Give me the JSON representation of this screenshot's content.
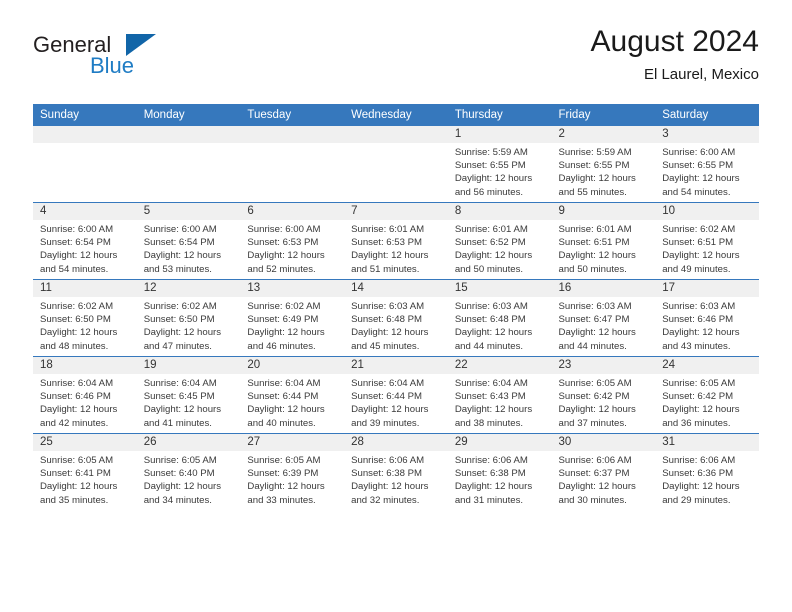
{
  "brand": {
    "name_part1": "General",
    "name_part2": "Blue",
    "logo_icon": "triangle-logo-icon"
  },
  "header": {
    "month_title": "August 2024",
    "location": "El Laurel, Mexico"
  },
  "colors": {
    "header_blue": "#3678bd",
    "brand_blue": "#1f7cc4",
    "daynum_bg": "#f0f0f0"
  },
  "weekday_headers": [
    "Sunday",
    "Monday",
    "Tuesday",
    "Wednesday",
    "Thursday",
    "Friday",
    "Saturday"
  ],
  "labels": {
    "sunrise_prefix": "Sunrise:",
    "sunset_prefix": "Sunset:",
    "daylight_prefix": "Daylight:"
  },
  "weeks": [
    [
      {
        "day": "",
        "sunrise": "",
        "sunset": "",
        "daylight_line1": "",
        "daylight_line2": "",
        "empty": true
      },
      {
        "day": "",
        "sunrise": "",
        "sunset": "",
        "daylight_line1": "",
        "daylight_line2": "",
        "empty": true
      },
      {
        "day": "",
        "sunrise": "",
        "sunset": "",
        "daylight_line1": "",
        "daylight_line2": "",
        "empty": true
      },
      {
        "day": "",
        "sunrise": "",
        "sunset": "",
        "daylight_line1": "",
        "daylight_line2": "",
        "empty": true
      },
      {
        "day": "1",
        "sunrise": "Sunrise: 5:59 AM",
        "sunset": "Sunset: 6:55 PM",
        "daylight_line1": "Daylight: 12 hours",
        "daylight_line2": "and 56 minutes.",
        "empty": false
      },
      {
        "day": "2",
        "sunrise": "Sunrise: 5:59 AM",
        "sunset": "Sunset: 6:55 PM",
        "daylight_line1": "Daylight: 12 hours",
        "daylight_line2": "and 55 minutes.",
        "empty": false
      },
      {
        "day": "3",
        "sunrise": "Sunrise: 6:00 AM",
        "sunset": "Sunset: 6:55 PM",
        "daylight_line1": "Daylight: 12 hours",
        "daylight_line2": "and 54 minutes.",
        "empty": false
      }
    ],
    [
      {
        "day": "4",
        "sunrise": "Sunrise: 6:00 AM",
        "sunset": "Sunset: 6:54 PM",
        "daylight_line1": "Daylight: 12 hours",
        "daylight_line2": "and 54 minutes.",
        "empty": false
      },
      {
        "day": "5",
        "sunrise": "Sunrise: 6:00 AM",
        "sunset": "Sunset: 6:54 PM",
        "daylight_line1": "Daylight: 12 hours",
        "daylight_line2": "and 53 minutes.",
        "empty": false
      },
      {
        "day": "6",
        "sunrise": "Sunrise: 6:00 AM",
        "sunset": "Sunset: 6:53 PM",
        "daylight_line1": "Daylight: 12 hours",
        "daylight_line2": "and 52 minutes.",
        "empty": false
      },
      {
        "day": "7",
        "sunrise": "Sunrise: 6:01 AM",
        "sunset": "Sunset: 6:53 PM",
        "daylight_line1": "Daylight: 12 hours",
        "daylight_line2": "and 51 minutes.",
        "empty": false
      },
      {
        "day": "8",
        "sunrise": "Sunrise: 6:01 AM",
        "sunset": "Sunset: 6:52 PM",
        "daylight_line1": "Daylight: 12 hours",
        "daylight_line2": "and 50 minutes.",
        "empty": false
      },
      {
        "day": "9",
        "sunrise": "Sunrise: 6:01 AM",
        "sunset": "Sunset: 6:51 PM",
        "daylight_line1": "Daylight: 12 hours",
        "daylight_line2": "and 50 minutes.",
        "empty": false
      },
      {
        "day": "10",
        "sunrise": "Sunrise: 6:02 AM",
        "sunset": "Sunset: 6:51 PM",
        "daylight_line1": "Daylight: 12 hours",
        "daylight_line2": "and 49 minutes.",
        "empty": false
      }
    ],
    [
      {
        "day": "11",
        "sunrise": "Sunrise: 6:02 AM",
        "sunset": "Sunset: 6:50 PM",
        "daylight_line1": "Daylight: 12 hours",
        "daylight_line2": "and 48 minutes.",
        "empty": false
      },
      {
        "day": "12",
        "sunrise": "Sunrise: 6:02 AM",
        "sunset": "Sunset: 6:50 PM",
        "daylight_line1": "Daylight: 12 hours",
        "daylight_line2": "and 47 minutes.",
        "empty": false
      },
      {
        "day": "13",
        "sunrise": "Sunrise: 6:02 AM",
        "sunset": "Sunset: 6:49 PM",
        "daylight_line1": "Daylight: 12 hours",
        "daylight_line2": "and 46 minutes.",
        "empty": false
      },
      {
        "day": "14",
        "sunrise": "Sunrise: 6:03 AM",
        "sunset": "Sunset: 6:48 PM",
        "daylight_line1": "Daylight: 12 hours",
        "daylight_line2": "and 45 minutes.",
        "empty": false
      },
      {
        "day": "15",
        "sunrise": "Sunrise: 6:03 AM",
        "sunset": "Sunset: 6:48 PM",
        "daylight_line1": "Daylight: 12 hours",
        "daylight_line2": "and 44 minutes.",
        "empty": false
      },
      {
        "day": "16",
        "sunrise": "Sunrise: 6:03 AM",
        "sunset": "Sunset: 6:47 PM",
        "daylight_line1": "Daylight: 12 hours",
        "daylight_line2": "and 44 minutes.",
        "empty": false
      },
      {
        "day": "17",
        "sunrise": "Sunrise: 6:03 AM",
        "sunset": "Sunset: 6:46 PM",
        "daylight_line1": "Daylight: 12 hours",
        "daylight_line2": "and 43 minutes.",
        "empty": false
      }
    ],
    [
      {
        "day": "18",
        "sunrise": "Sunrise: 6:04 AM",
        "sunset": "Sunset: 6:46 PM",
        "daylight_line1": "Daylight: 12 hours",
        "daylight_line2": "and 42 minutes.",
        "empty": false
      },
      {
        "day": "19",
        "sunrise": "Sunrise: 6:04 AM",
        "sunset": "Sunset: 6:45 PM",
        "daylight_line1": "Daylight: 12 hours",
        "daylight_line2": "and 41 minutes.",
        "empty": false
      },
      {
        "day": "20",
        "sunrise": "Sunrise: 6:04 AM",
        "sunset": "Sunset: 6:44 PM",
        "daylight_line1": "Daylight: 12 hours",
        "daylight_line2": "and 40 minutes.",
        "empty": false
      },
      {
        "day": "21",
        "sunrise": "Sunrise: 6:04 AM",
        "sunset": "Sunset: 6:44 PM",
        "daylight_line1": "Daylight: 12 hours",
        "daylight_line2": "and 39 minutes.",
        "empty": false
      },
      {
        "day": "22",
        "sunrise": "Sunrise: 6:04 AM",
        "sunset": "Sunset: 6:43 PM",
        "daylight_line1": "Daylight: 12 hours",
        "daylight_line2": "and 38 minutes.",
        "empty": false
      },
      {
        "day": "23",
        "sunrise": "Sunrise: 6:05 AM",
        "sunset": "Sunset: 6:42 PM",
        "daylight_line1": "Daylight: 12 hours",
        "daylight_line2": "and 37 minutes.",
        "empty": false
      },
      {
        "day": "24",
        "sunrise": "Sunrise: 6:05 AM",
        "sunset": "Sunset: 6:42 PM",
        "daylight_line1": "Daylight: 12 hours",
        "daylight_line2": "and 36 minutes.",
        "empty": false
      }
    ],
    [
      {
        "day": "25",
        "sunrise": "Sunrise: 6:05 AM",
        "sunset": "Sunset: 6:41 PM",
        "daylight_line1": "Daylight: 12 hours",
        "daylight_line2": "and 35 minutes.",
        "empty": false
      },
      {
        "day": "26",
        "sunrise": "Sunrise: 6:05 AM",
        "sunset": "Sunset: 6:40 PM",
        "daylight_line1": "Daylight: 12 hours",
        "daylight_line2": "and 34 minutes.",
        "empty": false
      },
      {
        "day": "27",
        "sunrise": "Sunrise: 6:05 AM",
        "sunset": "Sunset: 6:39 PM",
        "daylight_line1": "Daylight: 12 hours",
        "daylight_line2": "and 33 minutes.",
        "empty": false
      },
      {
        "day": "28",
        "sunrise": "Sunrise: 6:06 AM",
        "sunset": "Sunset: 6:38 PM",
        "daylight_line1": "Daylight: 12 hours",
        "daylight_line2": "and 32 minutes.",
        "empty": false
      },
      {
        "day": "29",
        "sunrise": "Sunrise: 6:06 AM",
        "sunset": "Sunset: 6:38 PM",
        "daylight_line1": "Daylight: 12 hours",
        "daylight_line2": "and 31 minutes.",
        "empty": false
      },
      {
        "day": "30",
        "sunrise": "Sunrise: 6:06 AM",
        "sunset": "Sunset: 6:37 PM",
        "daylight_line1": "Daylight: 12 hours",
        "daylight_line2": "and 30 minutes.",
        "empty": false
      },
      {
        "day": "31",
        "sunrise": "Sunrise: 6:06 AM",
        "sunset": "Sunset: 6:36 PM",
        "daylight_line1": "Daylight: 12 hours",
        "daylight_line2": "and 29 minutes.",
        "empty": false
      }
    ]
  ]
}
